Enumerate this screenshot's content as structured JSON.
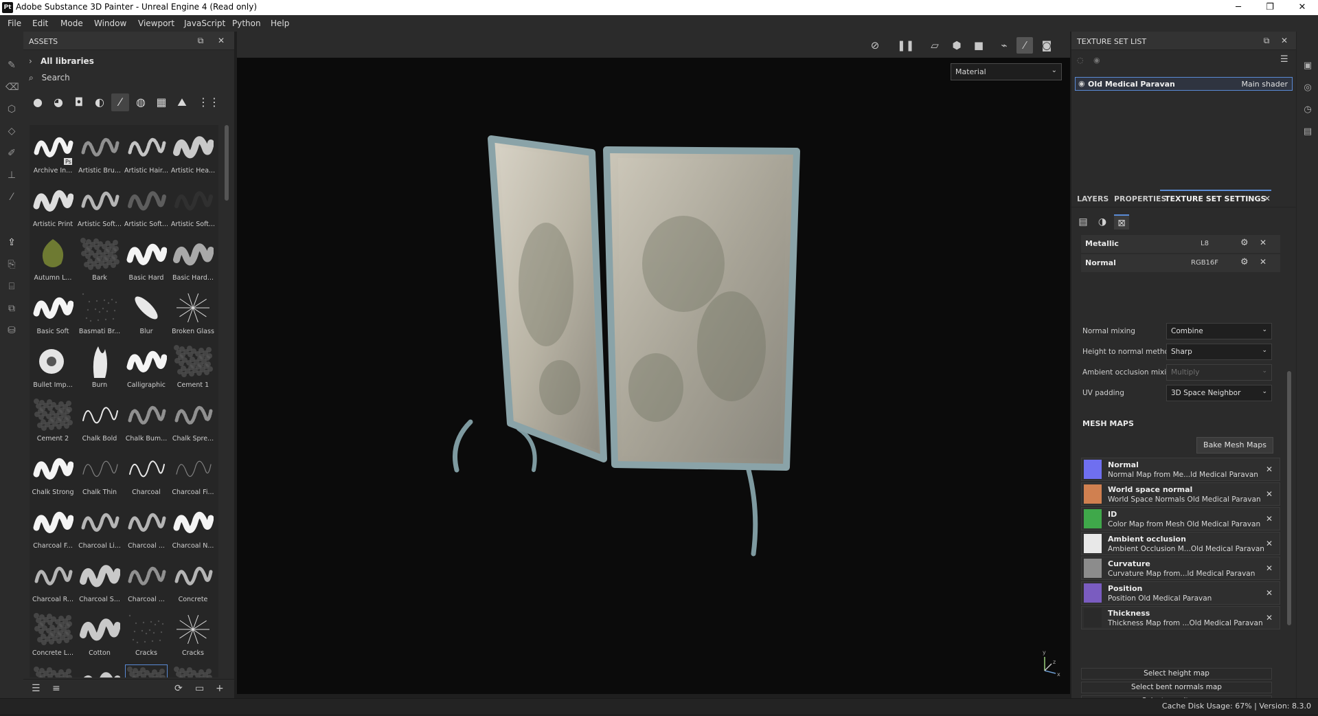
{
  "app": {
    "logo_text": "Pt",
    "title": "Adobe Substance 3D Painter - Unreal Engine 4 (Read only)",
    "window_buttons": [
      "─",
      "❐",
      "✕"
    ]
  },
  "menu": [
    "File",
    "Edit",
    "Mode",
    "Window",
    "Viewport",
    "JavaScript",
    "Python",
    "Help"
  ],
  "assets": {
    "title": "ASSETS",
    "library": "All libraries",
    "search_placeholder": "Search",
    "brushes": [
      {
        "name": "Archive In...",
        "style": "script",
        "badge": "Ps"
      },
      {
        "name": "Artistic Bru...",
        "style": "dots"
      },
      {
        "name": "Artistic Hair...",
        "style": "hair"
      },
      {
        "name": "Artistic Hea...",
        "style": "soft"
      },
      {
        "name": "Artistic Print",
        "style": "print"
      },
      {
        "name": "Artistic Soft...",
        "style": "stroke"
      },
      {
        "name": "Artistic Soft...",
        "style": "faint"
      },
      {
        "name": "Artistic Soft...",
        "style": "blank"
      },
      {
        "name": "Autumn L...",
        "style": "leaf"
      },
      {
        "name": "Bark",
        "style": "noise"
      },
      {
        "name": "Basic Hard",
        "style": "hard"
      },
      {
        "name": "Basic Hard...",
        "style": "gradient"
      },
      {
        "name": "Basic Soft",
        "style": "hard"
      },
      {
        "name": "Basmati Br...",
        "style": "speck"
      },
      {
        "name": "Blur",
        "style": "blur"
      },
      {
        "name": "Broken Glass",
        "style": "glass"
      },
      {
        "name": "Bullet Imp...",
        "style": "bullet"
      },
      {
        "name": "Burn",
        "style": "burn"
      },
      {
        "name": "Calligraphic",
        "style": "hard"
      },
      {
        "name": "Cement 1",
        "style": "noise"
      },
      {
        "name": "Cement 2",
        "style": "noise"
      },
      {
        "name": "Chalk Bold",
        "style": "line"
      },
      {
        "name": "Chalk Bum...",
        "style": "dots"
      },
      {
        "name": "Chalk Spre...",
        "style": "dots"
      },
      {
        "name": "Chalk Strong",
        "style": "hard"
      },
      {
        "name": "Chalk Thin",
        "style": "thin"
      },
      {
        "name": "Charcoal",
        "style": "line"
      },
      {
        "name": "Charcoal Fi...",
        "style": "thin"
      },
      {
        "name": "Charcoal F...",
        "style": "hard"
      },
      {
        "name": "Charcoal Li...",
        "style": "stroke"
      },
      {
        "name": "Charcoal ...",
        "style": "stroke"
      },
      {
        "name": "Charcoal N...",
        "style": "hard"
      },
      {
        "name": "Charcoal R...",
        "style": "stroke"
      },
      {
        "name": "Charcoal S...",
        "style": "soft"
      },
      {
        "name": "Charcoal ...",
        "style": "dots"
      },
      {
        "name": "Concrete",
        "style": "stroke"
      },
      {
        "name": "Concrete L...",
        "style": "noise"
      },
      {
        "name": "Cotton",
        "style": "soft"
      },
      {
        "name": "Cracks",
        "style": "speck"
      },
      {
        "name": "Cracks",
        "style": "cracks"
      },
      {
        "name": "",
        "style": "noise"
      },
      {
        "name": "",
        "style": "soft"
      },
      {
        "name": "",
        "style": "noise"
      },
      {
        "name": "",
        "style": "noise"
      }
    ],
    "selected_index": 42
  },
  "viewport": {
    "material_label": "Material",
    "axes": [
      "y",
      "z",
      "x"
    ]
  },
  "texture_set_list": {
    "title": "TEXTURE SET LIST",
    "item_name": "Old Medical Paravan",
    "item_shader": "Main shader"
  },
  "tabs": {
    "layers": "LAYERS",
    "properties": "PROPERTIES",
    "tss": "TEXTURE SET SETTINGS"
  },
  "channels": [
    {
      "name": "Metallic",
      "format": "L8"
    },
    {
      "name": "Normal",
      "format": "RGB16F"
    }
  ],
  "settings": [
    {
      "label": "Normal mixing",
      "value": "Combine",
      "disabled": false
    },
    {
      "label": "Height to normal method",
      "value": "Sharp",
      "disabled": false
    },
    {
      "label": "Ambient occlusion mixing",
      "value": "Multiply",
      "disabled": true
    },
    {
      "label": "UV padding",
      "value": "3D Space Neighbor",
      "disabled": false
    }
  ],
  "mesh_maps": {
    "title": "MESH MAPS",
    "bake_label": "Bake Mesh Maps",
    "items": [
      {
        "title": "Normal",
        "sub": "Normal Map from Me...ld Medical Paravan",
        "color": "#6f6ff0"
      },
      {
        "title": "World space normal",
        "sub": "World Space Normals Old Medical Paravan",
        "color": "#d08050"
      },
      {
        "title": "ID",
        "sub": "Color Map from Mesh Old Medical Paravan",
        "color": "#3fa84a"
      },
      {
        "title": "Ambient occlusion",
        "sub": "Ambient Occlusion M...Old Medical Paravan",
        "color": "#e8e8e8"
      },
      {
        "title": "Curvature",
        "sub": "Curvature Map from...ld Medical Paravan",
        "color": "#8c8c8c"
      },
      {
        "title": "Position",
        "sub": "Position Old Medical Paravan",
        "color": "#7a5cc0"
      },
      {
        "title": "Thickness",
        "sub": "Thickness Map from ...Old Medical Paravan",
        "color": "#2a2a2a"
      }
    ],
    "select_buttons": [
      "Select height map",
      "Select bent normals map",
      "Select opacity map"
    ]
  },
  "status": {
    "text": "Cache Disk Usage:   67% | Version: 8.3.0"
  }
}
